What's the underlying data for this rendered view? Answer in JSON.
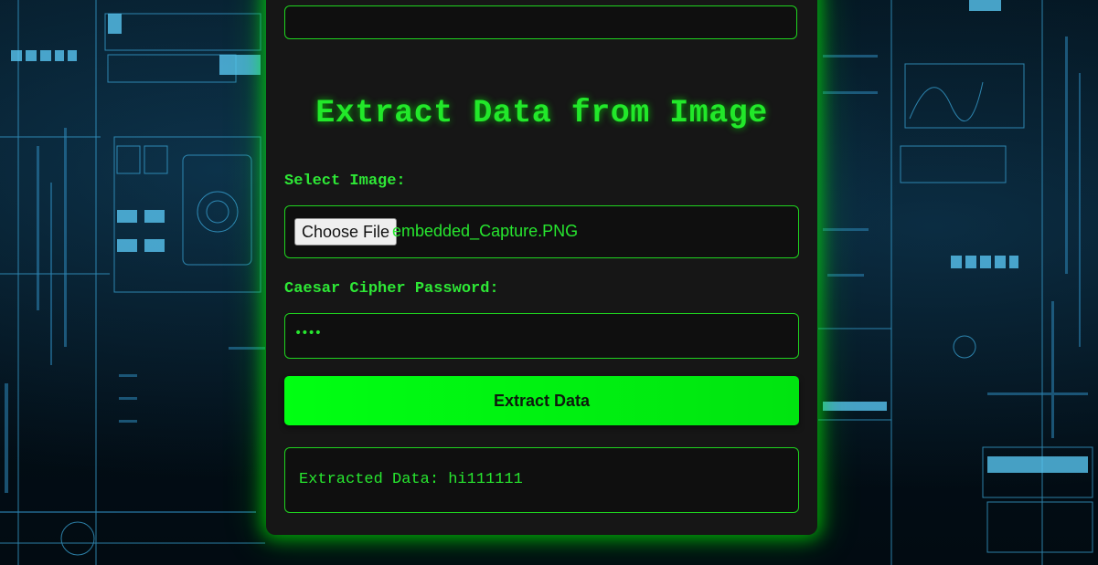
{
  "panel": {
    "title": "Extract Data from Image"
  },
  "image_field": {
    "label": "Select Image:",
    "button_label": "Choose File",
    "file_name": "embedded_Capture.PNG"
  },
  "password_field": {
    "label": "Caesar Cipher Password:",
    "masked_value": "••••"
  },
  "extract_button": {
    "label": "Extract Data"
  },
  "result": {
    "text": "Extracted Data: hi111111"
  },
  "colors": {
    "accent": "#00ff12",
    "text_green": "#27e62f",
    "panel": "#161616",
    "field": "#0f0f0f"
  }
}
